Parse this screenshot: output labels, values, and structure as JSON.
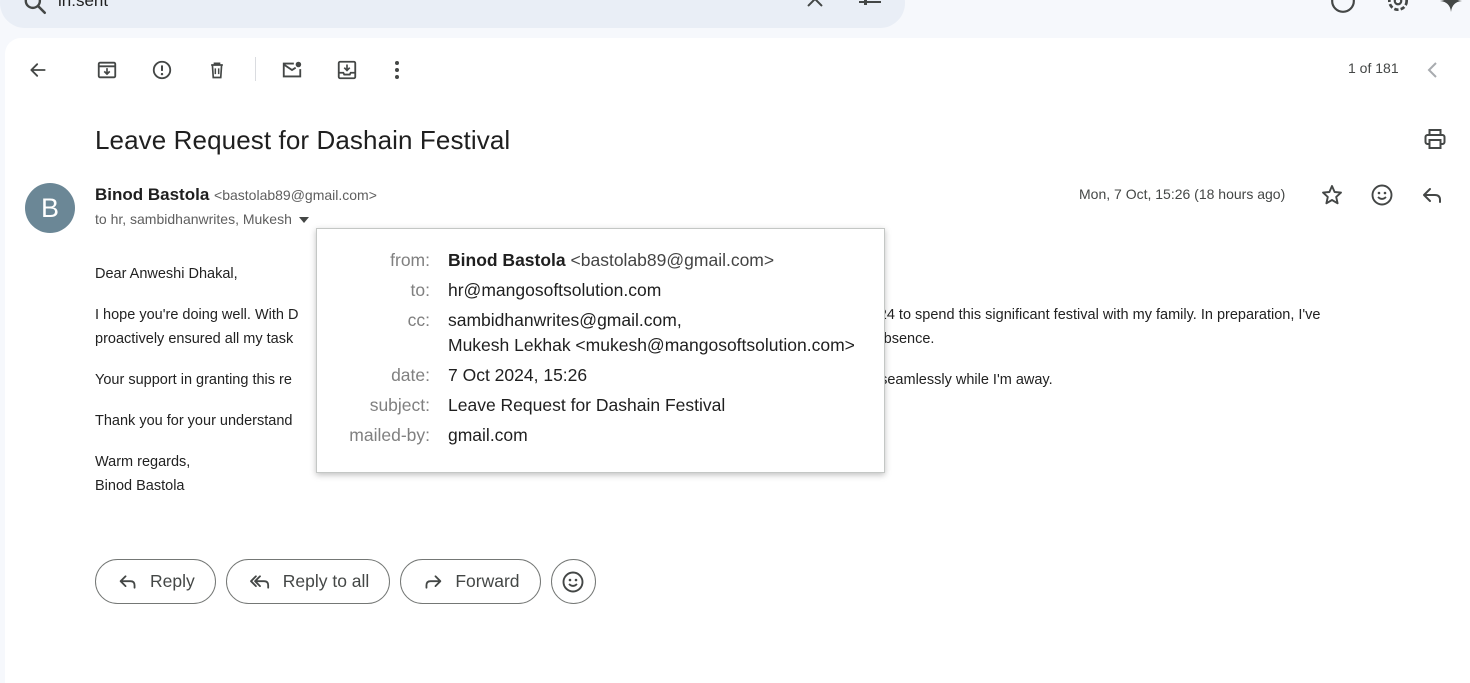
{
  "search": {
    "query": "in:sent"
  },
  "toolbar": {
    "pager": "1 of 181"
  },
  "email": {
    "subject": "Leave Request for Dashain Festival",
    "avatar_letter": "B",
    "sender_name": "Binod Bastola",
    "sender_email": "<bastolab89@gmail.com>",
    "recipients_summary": "to hr, sambidhanwrites, Mukesh",
    "date": "Mon, 7 Oct, 15:26 (18 hours ago)",
    "body": {
      "greeting": "Dear Anweshi Dhakal,",
      "para1_left": "I hope you're doing well. With D",
      "para1_right": "81/06/24 to spend this significant festival with my family. In preparation, I've",
      "para1_line2_left": "proactively ensured all my task",
      "para1_line2_right": "ny absence.",
      "para2_left": "Your support in granting this re",
      "para2_right": "ue seamlessly while I'm away.",
      "para3_left": "Thank you for your understand",
      "closing": "Warm regards,",
      "signature": "Binod Bastola"
    }
  },
  "actions": {
    "reply": "Reply",
    "reply_all": "Reply to all",
    "forward": "Forward"
  },
  "details": {
    "from_label": "from:",
    "from_name": "Binod Bastola",
    "from_email": "<bastolab89@gmail.com>",
    "to_label": "to:",
    "to_value": "hr@mangosoftsolution.com",
    "cc_label": "cc:",
    "cc_value_1": "sambidhanwrites@gmail.com,",
    "cc_value_2": "Mukesh Lekhak <mukesh@mangosoftsolution.com>",
    "date_label": "date:",
    "date_value": "7 Oct 2024, 15:26",
    "subject_label": "subject:",
    "subject_value": "Leave Request for Dashain Festival",
    "mailedby_label": "mailed-by:",
    "mailedby_value": "gmail.com"
  }
}
